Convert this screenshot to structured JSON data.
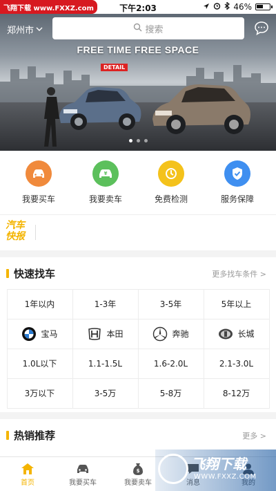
{
  "status": {
    "watermark": "飞翔下载 www.FXXZ.com",
    "time": "下午2:03",
    "battery": "46%"
  },
  "topbar": {
    "city": "郑州市",
    "search_placeholder": "搜索"
  },
  "banner": {
    "headline": "FREE TIME FREE SPACE",
    "detail": "DETAIL",
    "slides": 3,
    "active_slide": 1
  },
  "quick": [
    {
      "label": "我要买车",
      "icon": "car-icon",
      "color": "#f08a3c"
    },
    {
      "label": "我要卖车",
      "icon": "sell-car-icon",
      "color": "#5cc05c"
    },
    {
      "label": "免费检测",
      "icon": "inspection-icon",
      "color": "#f4c21b"
    },
    {
      "label": "服务保障",
      "icon": "shield-icon",
      "color": "#3f8ff0"
    }
  ],
  "news": {
    "logo": "汽车快报"
  },
  "find": {
    "title": "快速找车",
    "more": "更多找车条件 >",
    "rows": [
      [
        "1年以内",
        "1-3年",
        "3-5年",
        "5年以上"
      ],
      [
        "宝马",
        "本田",
        "奔驰",
        "长城"
      ],
      [
        "1.0L以下",
        "1.1-1.5L",
        "1.6-2.0L",
        "2.1-3.0L"
      ],
      [
        "3万以下",
        "3-5万",
        "5-8万",
        "8-12万"
      ]
    ]
  },
  "hot": {
    "title": "热销推荐",
    "more": "更多 >"
  },
  "tabs": [
    {
      "label": "首页",
      "icon": "home-icon",
      "active": true
    },
    {
      "label": "我要买车",
      "icon": "car-icon"
    },
    {
      "label": "我要卖车",
      "icon": "money-bag-icon"
    },
    {
      "label": "消息",
      "icon": "message-icon"
    },
    {
      "label": "我的",
      "icon": "user-icon"
    }
  ],
  "overlay_watermark": {
    "title": "飞翔下载",
    "url": "WWW.FXXZ.COM"
  },
  "colors": {
    "accent": "#f4b400",
    "brand_red": "#d71920"
  }
}
